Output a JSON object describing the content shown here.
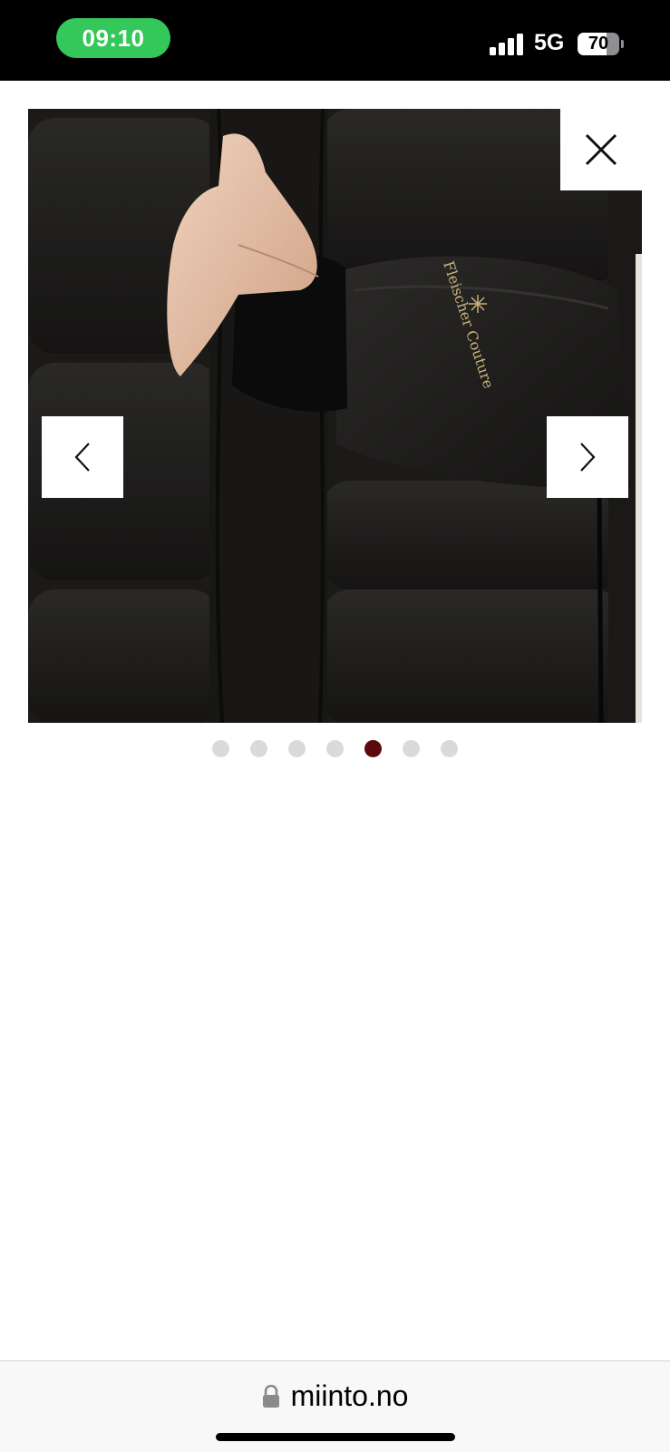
{
  "status_bar": {
    "time": "09:10",
    "network": "5G",
    "battery": "70",
    "battery_level": 0.7,
    "signal_bars": 4
  },
  "gallery": {
    "image_subject": "black puffer jacket close-up with hand in pocket",
    "sleeve_print": "Fleischer Couture",
    "image_count": 7,
    "active_index": 4,
    "close_icon": "close-icon",
    "prev_icon": "chevron-left-icon",
    "next_icon": "chevron-right-icon"
  },
  "colors": {
    "active_dot": "#5a0a0f",
    "inactive_dot": "#dadada",
    "status_green": "#34c759"
  },
  "browser": {
    "url": "miinto.no",
    "lock_icon": "lock-icon"
  }
}
